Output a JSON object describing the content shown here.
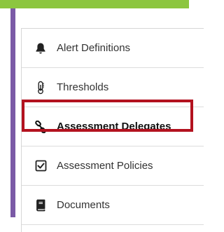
{
  "colors": {
    "top_bar": "#8cc63f",
    "left_stripe": "#7b5aa6",
    "highlight_border": "#b3121f"
  },
  "menu": {
    "items": [
      {
        "label": "Alert Definitions",
        "icon": "bell-icon"
      },
      {
        "label": "Thresholds",
        "icon": "thermometer-icon"
      },
      {
        "label": "Assessment Delegates",
        "icon": "link-icon"
      },
      {
        "label": "Assessment Policies",
        "icon": "checkbox-icon"
      },
      {
        "label": "Documents",
        "icon": "book-icon"
      }
    ],
    "active_item": "Assessment Delegates"
  }
}
